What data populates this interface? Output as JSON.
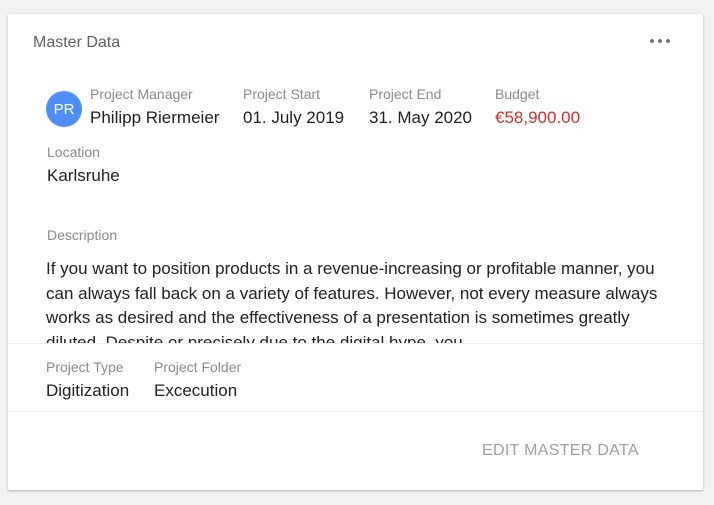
{
  "card": {
    "title": "Master Data",
    "more_icon": "more-horizontal-icon"
  },
  "project_manager": {
    "label": "Project Manager",
    "initials": "PR",
    "name": "Philipp Riermeier",
    "avatar_color": "#4f8ef7"
  },
  "project_start": {
    "label": "Project Start",
    "value": "01. July 2019"
  },
  "project_end": {
    "label": "Project End",
    "value": "31. May 2020"
  },
  "budget": {
    "label": "Budget",
    "value": "€58,900.00",
    "color": "#d32f2f"
  },
  "location": {
    "label": "Location",
    "value": "Karlsruhe"
  },
  "description": {
    "label": "Description",
    "text": "If you want to position products in a revenue-increasing or profitable manner, you can always fall back on a variety of features. However, not every measure always works as desired and the effectiveness of a presentation is sometimes greatly diluted. Despite or precisely due to the digital hype, you"
  },
  "project_type": {
    "label": "Project Type",
    "value": "Digitization"
  },
  "project_folder": {
    "label": "Project Folder",
    "value": "Excecution"
  },
  "actions": {
    "edit_label": "EDIT MASTER DATA"
  }
}
